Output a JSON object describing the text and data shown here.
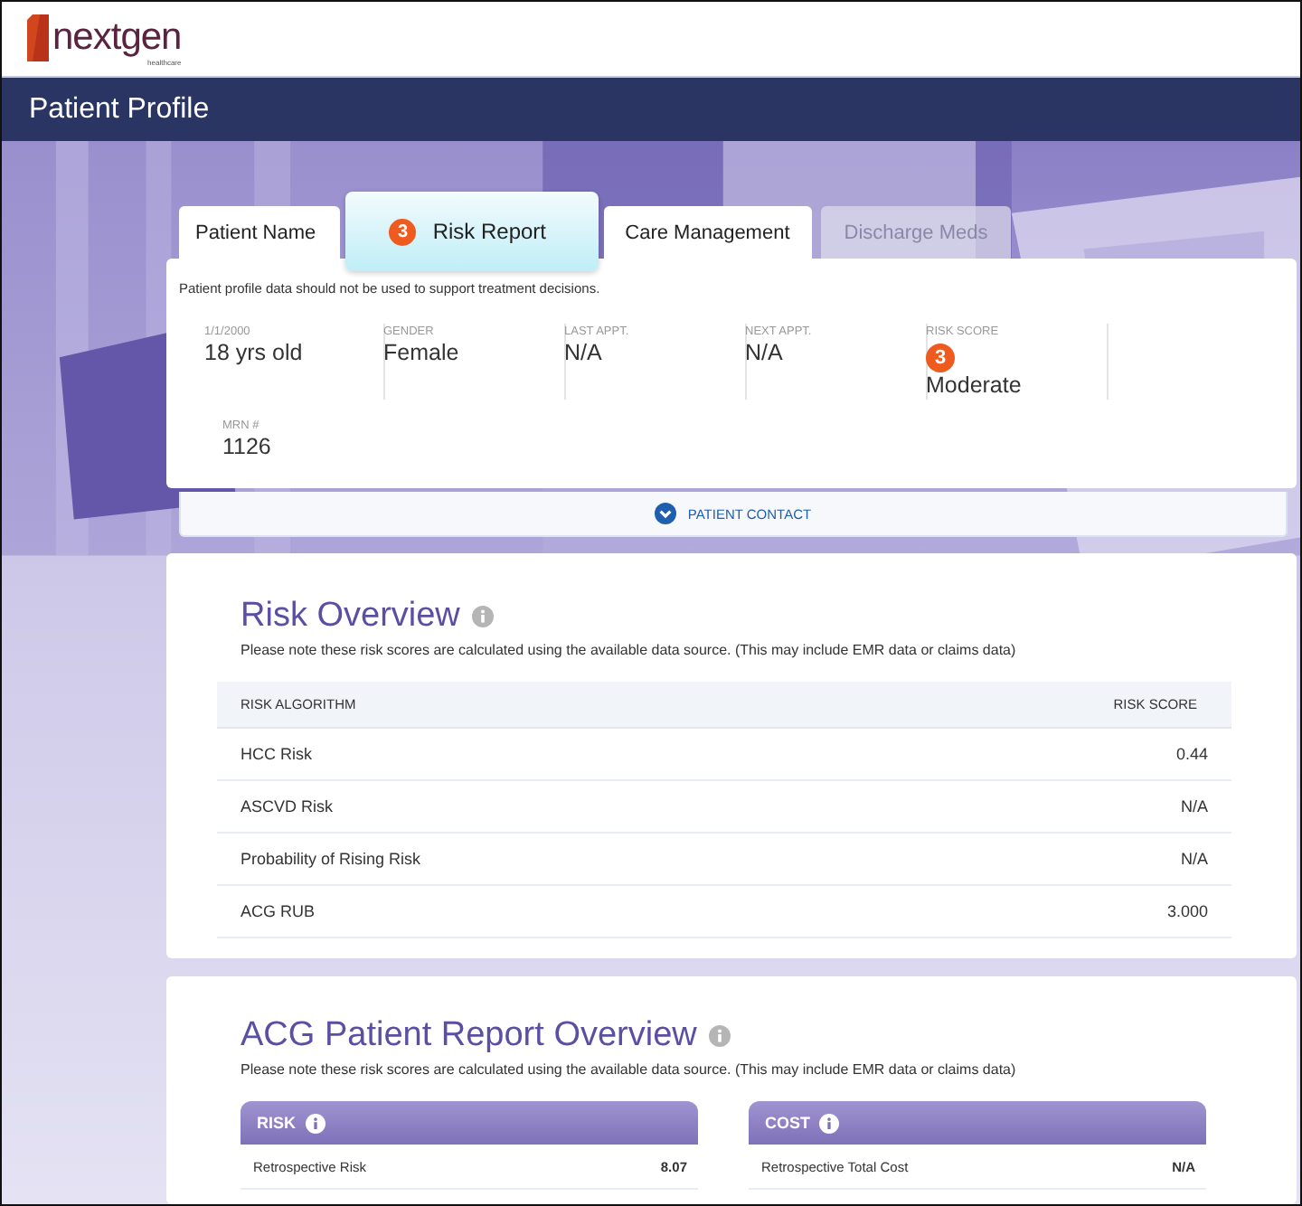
{
  "logo": {
    "name": "nextgen",
    "tagline": "healthcare"
  },
  "page_title": "Patient Profile",
  "tabs": [
    {
      "label": "Patient Name",
      "selected": false,
      "disabled": false
    },
    {
      "label": "Risk Report",
      "badge": "3",
      "selected": true,
      "disabled": false
    },
    {
      "label": "Care Management",
      "selected": false,
      "disabled": false
    },
    {
      "label": "Discharge Meds",
      "selected": false,
      "disabled": true
    }
  ],
  "profile": {
    "disclaimer": "Patient profile data should not be used to support treatment decisions.",
    "fields": [
      {
        "kind": "plain",
        "label": "1/1/2000",
        "value": "18 yrs old"
      },
      {
        "kind": "plain",
        "label": "GENDER",
        "value": "Female"
      },
      {
        "kind": "plain",
        "label": "LAST APPT.",
        "value": "N/A"
      },
      {
        "kind": "plain",
        "label": "NEXT APPT.",
        "value": "N/A"
      },
      {
        "kind": "score",
        "label": "RISK SCORE",
        "badge": "3",
        "value": "Moderate"
      },
      {
        "kind": "plain",
        "label": "MRN #",
        "value": "1126"
      }
    ],
    "contact_toggle": {
      "label": "PATIENT CONTACT",
      "expanded": false
    }
  },
  "risk_overview": {
    "title": "Risk Overview",
    "note": "Please note these risk scores are calculated using the available data source. (This may include EMR data or claims data)",
    "columns": [
      "RISK ALGORITHM",
      "RISK SCORE"
    ],
    "rows": [
      [
        "HCC Risk",
        "0.44"
      ],
      [
        "ASCVD Risk",
        "N/A"
      ],
      [
        "Probability of Rising Risk",
        "N/A"
      ],
      [
        "ACG RUB",
        "3.000"
      ]
    ]
  },
  "acg_overview": {
    "title": "ACG Patient Report Overview",
    "note": "Please note these risk scores are calculated using the available data source. (This may include EMR data or claims data)",
    "panels": [
      {
        "title": "RISK",
        "rows": [
          [
            "Retrospective Risk",
            "8.07"
          ]
        ]
      },
      {
        "title": "COST",
        "rows": [
          [
            "Retrospective Total Cost",
            "N/A"
          ]
        ]
      }
    ]
  }
}
